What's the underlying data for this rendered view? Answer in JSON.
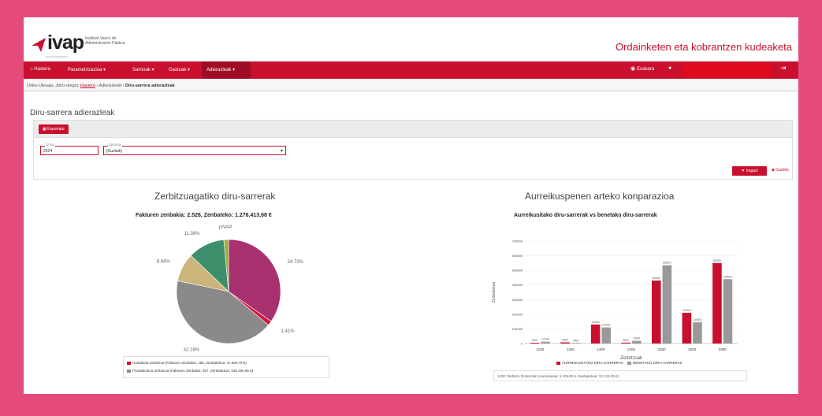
{
  "header": {
    "logo_text": "ivap",
    "logo_sub_1": "Instituto Vasco de",
    "logo_sub_2": "Administración Pública",
    "logo_tiny": "Herri Arduralaritzaren",
    "app_title": "Ordainketen eta kobrantzen kudeaketa"
  },
  "nav": {
    "items": [
      "⌂ Hasiera",
      "Parametrizazioa ▾",
      "Sarrerak ▾",
      "Gastuak ▾",
      "Adierazleak ▾"
    ],
    "lang": "Euskara",
    "colors": {
      "primary": "#c8102e",
      "active": "#9e0d25"
    }
  },
  "breadcrumb": {
    "prefix": "Uribe-Ulesaja, Jbiru-olegoi:",
    "home": "Hasiera",
    "middle": "› Adierazleak ›",
    "current": "Diru-sarrera adierazleak"
  },
  "page": {
    "title": "Diru-sarrera adierazleak",
    "export_label": "Esportatu",
    "year_label": "Urtea",
    "year_value": "2024",
    "center_label": "Zentroa",
    "center_value": "[Guztiak]",
    "filter_label": "Iragazi",
    "clear_label": "Garbitu"
  },
  "pie_chart": {
    "title": "Zerbitzuagatiko diru-sarrerak",
    "subtitle": "Fakturen zenbakia: 2.526, Zenbateko: 1.276.413,68 €",
    "legend": [
      "Hautaketa Zerbitzua (Fakturen Zenbakia: 456, Zenbatekoa: 47.850,79 €)",
      "Prestakuntza Zerbitzua (Fakturen Zenbakia: 927, Zenbatekoa: 535.366,95 €)"
    ]
  },
  "bar_chart": {
    "title": "Aurreikuspenen arteko konparazioa",
    "subtitle": "Aurreikusitako diru-sarrerak vs benetako diru-sarrerak",
    "legend_1": "AURREIKUSITAKO DIRU-SARRERAK",
    "legend_2": "BENETAKO DIRU-SARRERAK",
    "note": "1100: Zerbitzu Orokorrak (Aurreikusita: 5.105,00 €, Zenbatekoa: 12.124,03 €)"
  },
  "chart_data": [
    {
      "type": "pie",
      "title": "Fakturen zenbakia: 2.526, Zenbateko: 1.276.413,68 €",
      "slices": [
        {
          "label": "34.73%",
          "value": 34.73,
          "color": "#a8306e"
        },
        {
          "label": "1.41%",
          "value": 1.41,
          "color": "#d4143c"
        },
        {
          "label": "42.18%",
          "value": 42.18,
          "color": "#8a8a8a"
        },
        {
          "label": "8.84%",
          "value": 8.84,
          "color": "#cbb57a"
        },
        {
          "label": "11.38%",
          "value": 11.38,
          "color": "#3c8f6a"
        },
        {
          "label": "pIVAP",
          "value": 1.46,
          "color": "#9aae3c"
        }
      ]
    },
    {
      "type": "bar",
      "title": "Aurreikusitako diru-sarrerak vs benetako diru-sarrerak",
      "xlabel": "Zerbitzuak",
      "ylabel": "Zenbatekoa",
      "categories": [
        "1100",
        "1200",
        "1300",
        "2200",
        "2300",
        "3200",
        "3300"
      ],
      "ylim": [
        0,
        700000
      ],
      "yticks": [
        "0",
        "100000",
        "200000",
        "300000",
        "400000",
        "500000",
        "600000",
        "700000"
      ],
      "series": [
        {
          "name": "AURREIKUSITAKO DIRU-SARRERAK",
          "color": "#c8102e",
          "values": [
            5105,
            8000,
            130000,
            6000,
            430000,
            210000,
            550000
          ]
        },
        {
          "name": "BENETAKO DIRU-SARRERAK",
          "color": "#999999",
          "values": [
            12124,
            4000,
            110000,
            18000,
            535000,
            145000,
            440000
          ]
        }
      ]
    }
  ]
}
